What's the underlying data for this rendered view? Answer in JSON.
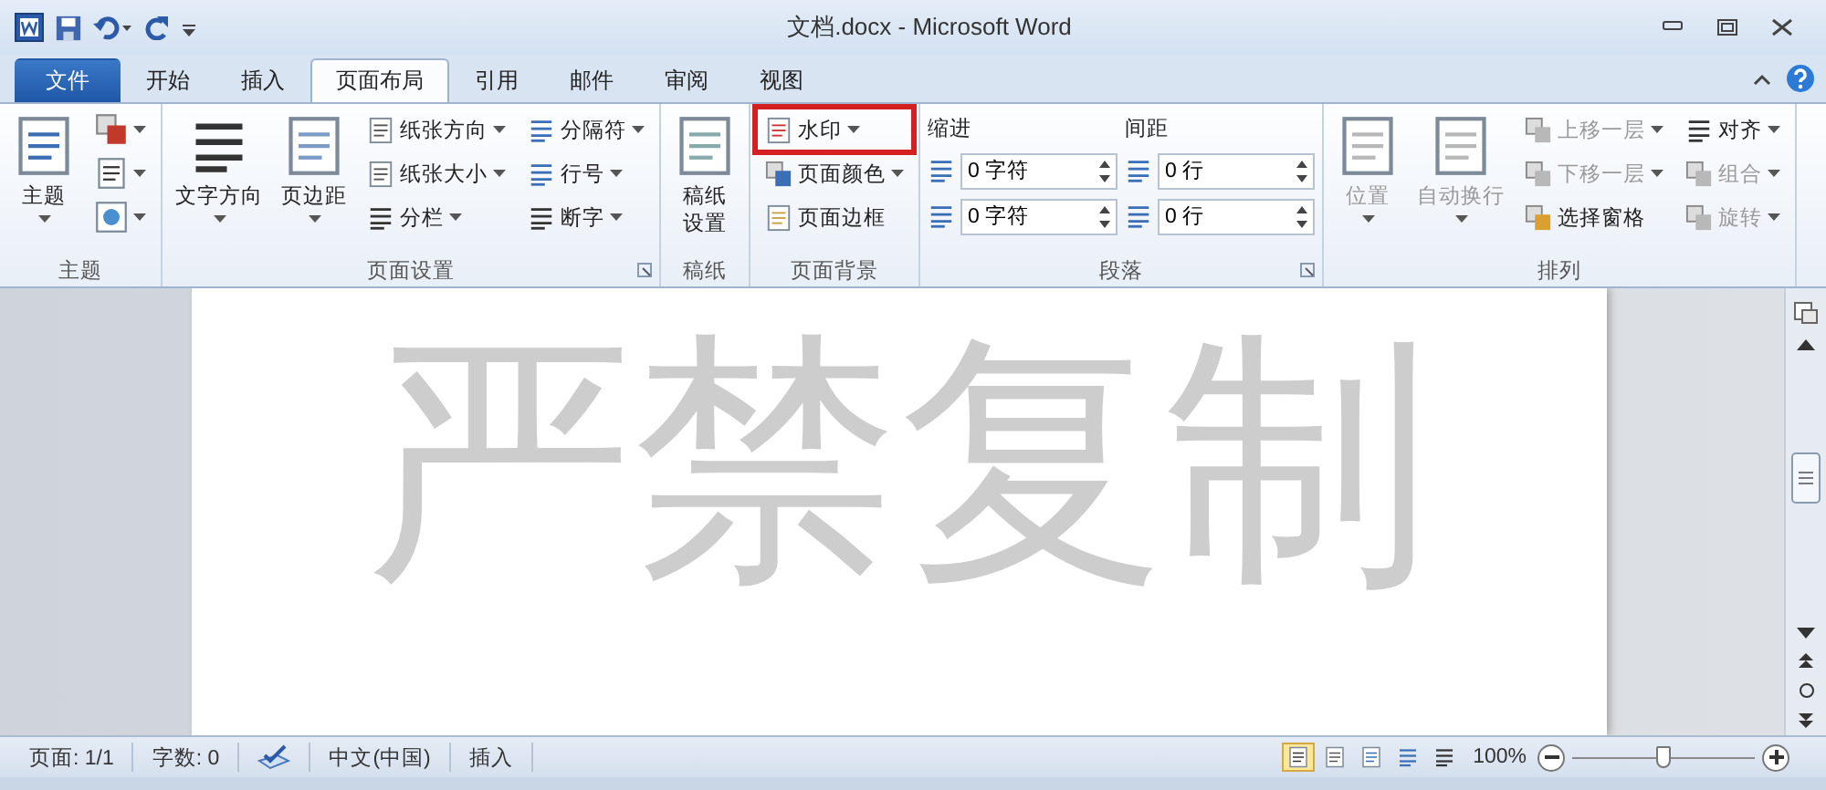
{
  "title_bar": {
    "title": "文档.docx - Microsoft Word"
  },
  "tabs": [
    {
      "label": "文件",
      "kind": "file",
      "selected": false
    },
    {
      "label": "开始",
      "kind": "tab",
      "selected": false
    },
    {
      "label": "插入",
      "kind": "tab",
      "selected": false
    },
    {
      "label": "页面布局",
      "kind": "tab",
      "selected": true
    },
    {
      "label": "引用",
      "kind": "tab",
      "selected": false
    },
    {
      "label": "邮件",
      "kind": "tab",
      "selected": false
    },
    {
      "label": "审阅",
      "kind": "tab",
      "selected": false
    },
    {
      "label": "视图",
      "kind": "tab",
      "selected": false
    }
  ],
  "ribbon": [
    {
      "label": "主题",
      "launcher": false,
      "columns": [
        [
          {
            "kind": "large",
            "label": "主题",
            "dropdown": true
          }
        ],
        [
          {
            "kind": "icon",
            "dropdown": true
          },
          {
            "kind": "icon",
            "dropdown": true
          },
          {
            "kind": "icon",
            "dropdown": true
          }
        ]
      ]
    },
    {
      "label": "页面设置",
      "launcher": true,
      "columns": [
        [
          {
            "kind": "large",
            "label": "文字方向",
            "dropdown": true
          }
        ],
        [
          {
            "kind": "large",
            "label": "页边距",
            "dropdown": true
          }
        ],
        [
          {
            "kind": "small",
            "label": "纸张方向",
            "dropdown": true
          },
          {
            "kind": "small",
            "label": "纸张大小",
            "dropdown": true
          },
          {
            "kind": "small",
            "label": "分栏",
            "dropdown": true
          }
        ],
        [
          {
            "kind": "small",
            "label": "分隔符",
            "dropdown": true
          },
          {
            "kind": "small",
            "label": "行号",
            "dropdown": true
          },
          {
            "kind": "small",
            "label": "断字",
            "dropdown": true
          }
        ]
      ]
    },
    {
      "label": "稿纸",
      "launcher": false,
      "columns": [
        [
          {
            "kind": "large",
            "label": "稿纸设置",
            "wrap": true
          }
        ]
      ]
    },
    {
      "label": "页面背景",
      "launcher": false,
      "columns": [
        [
          {
            "kind": "small",
            "label": "水印",
            "dropdown": true,
            "highlighted": true
          },
          {
            "kind": "small",
            "label": "页面颜色",
            "dropdown": true
          },
          {
            "kind": "small",
            "label": "页面边框"
          }
        ]
      ]
    },
    {
      "label": "段落",
      "launcher": true,
      "columns": [
        [
          {
            "kind": "heading",
            "label": "缩进"
          },
          {
            "kind": "spin",
            "value": "0 字符"
          },
          {
            "kind": "spin",
            "value": "0 字符"
          }
        ],
        [
          {
            "kind": "heading",
            "label": "间距"
          },
          {
            "kind": "spin",
            "value": "0 行"
          },
          {
            "kind": "spin",
            "value": "0 行"
          }
        ]
      ]
    },
    {
      "label": "排列",
      "launcher": false,
      "columns": [
        [
          {
            "kind": "large",
            "label": "位置",
            "dropdown": true,
            "disabled": true
          }
        ],
        [
          {
            "kind": "large",
            "label": "自动换行",
            "dropdown": true,
            "disabled": true
          }
        ],
        [
          {
            "kind": "small",
            "label": "上移一层",
            "dropdown": true,
            "disabled": true
          },
          {
            "kind": "small",
            "label": "下移一层",
            "dropdown": true,
            "disabled": true
          },
          {
            "kind": "small",
            "label": "选择窗格"
          }
        ],
        [
          {
            "kind": "small",
            "label": "对齐",
            "dropdown": true
          },
          {
            "kind": "small",
            "label": "组合",
            "dropdown": true,
            "disabled": true
          },
          {
            "kind": "small",
            "label": "旋转",
            "dropdown": true,
            "disabled": true
          }
        ]
      ]
    }
  ],
  "document": {
    "watermark": "严禁复制"
  },
  "status_bar": {
    "items": [
      {
        "kind": "text",
        "label": "页面: 1/1"
      },
      {
        "kind": "text",
        "label": "字数: 0"
      },
      {
        "kind": "proofing"
      },
      {
        "kind": "text",
        "label": "中文(中国)"
      },
      {
        "kind": "text",
        "label": "插入"
      }
    ],
    "views": [
      {
        "selected": true
      },
      {
        "selected": false
      },
      {
        "selected": false
      },
      {
        "selected": false
      },
      {
        "selected": false
      }
    ],
    "zoom": "100%",
    "zoom_slider": {
      "level": 0.5
    }
  }
}
